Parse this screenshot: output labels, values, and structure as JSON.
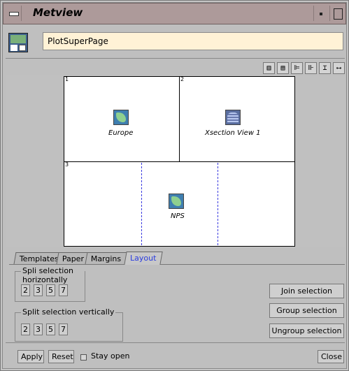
{
  "window": {
    "title": "Metview"
  },
  "header": {
    "page_name": "PlotSuperPage",
    "page_icon": "plot-superpage-icon"
  },
  "toolbar": {
    "buttons": [
      {
        "icon": "bars-align-bottom-icon",
        "glyph": "▥"
      },
      {
        "icon": "bars-align-top-icon",
        "glyph": "▤"
      },
      {
        "icon": "align-left-icon",
        "glyph": "⊫"
      },
      {
        "icon": "align-right-icon",
        "glyph": "⊪"
      },
      {
        "icon": "distribute-vertical-icon",
        "glyph": "⌶"
      },
      {
        "icon": "distribute-horizontal-icon",
        "glyph": "⟷"
      }
    ]
  },
  "layout": {
    "cells": [
      {
        "number": "1",
        "label": "Europe",
        "icon": "map-view-icon"
      },
      {
        "number": "2",
        "label": "Xsection View 1",
        "icon": "xsection-view-icon"
      },
      {
        "number": "3",
        "label": "NPS",
        "icon": "map-view-icon"
      }
    ]
  },
  "tabs": [
    {
      "label": "Templates",
      "active": false
    },
    {
      "label": "Paper",
      "active": false
    },
    {
      "label": "Margins",
      "active": false
    },
    {
      "label": "Layout",
      "active": true
    }
  ],
  "split_horizontal": {
    "title": "Spli selection horizontally",
    "options": [
      "2",
      "3",
      "5",
      "7"
    ]
  },
  "split_vertical": {
    "title": "Split selection vertically",
    "options": [
      "2",
      "3",
      "5",
      "7"
    ]
  },
  "actions": {
    "join": "Join selection",
    "group": "Group selection",
    "ungroup": "Ungroup selection"
  },
  "footer": {
    "apply": "Apply",
    "reset": "Reset",
    "stay_open": "Stay open",
    "close": "Close"
  }
}
